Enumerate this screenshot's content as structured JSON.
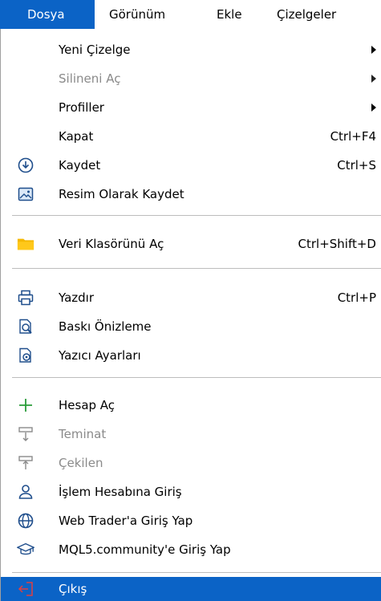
{
  "menubar": {
    "items": [
      {
        "label": "Dosya"
      },
      {
        "label": "Görünüm"
      },
      {
        "label": "Ekle"
      },
      {
        "label": "Çizelgeler"
      }
    ]
  },
  "dosya_menu": {
    "items": [
      {
        "label": "Yeni Çizelge",
        "shortcut": ""
      },
      {
        "label": "Silineni Aç",
        "shortcut": ""
      },
      {
        "label": "Profiller",
        "shortcut": ""
      },
      {
        "label": "Kapat",
        "shortcut": "Ctrl+F4"
      },
      {
        "label": "Kaydet",
        "shortcut": "Ctrl+S"
      },
      {
        "label": "Resim Olarak Kaydet",
        "shortcut": ""
      },
      {
        "label": "Veri Klasörünü Aç",
        "shortcut": "Ctrl+Shift+D"
      },
      {
        "label": "Yazdır",
        "shortcut": "Ctrl+P"
      },
      {
        "label": "Baskı Önizleme",
        "shortcut": ""
      },
      {
        "label": "Yazıcı Ayarları",
        "shortcut": ""
      },
      {
        "label": "Hesap Aç",
        "shortcut": ""
      },
      {
        "label": "Teminat",
        "shortcut": ""
      },
      {
        "label": "Çekilen",
        "shortcut": ""
      },
      {
        "label": "İşlem Hesabına Giriş",
        "shortcut": ""
      },
      {
        "label": "Web Trader'a Giriş Yap",
        "shortcut": ""
      },
      {
        "label": "MQL5.community'e Giriş Yap",
        "shortcut": ""
      },
      {
        "label": "Çıkış",
        "shortcut": ""
      }
    ]
  },
  "colors": {
    "highlight": "#0b63c6",
    "folder": "#f5b800",
    "plus": "#2a9d3a",
    "exit": "#e04040"
  }
}
